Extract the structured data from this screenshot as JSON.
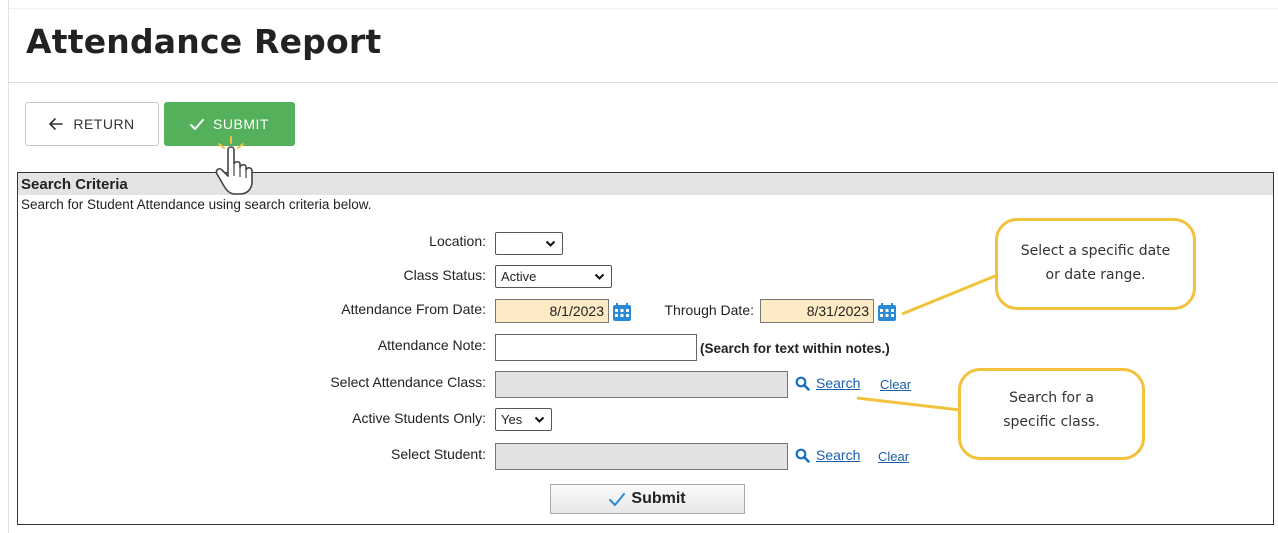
{
  "page": {
    "title": "Attendance Report"
  },
  "toolbar": {
    "return_label": "RETURN",
    "submit_label": "SUBMIT"
  },
  "panel": {
    "header": "Search Criteria",
    "subtitle": "Search for Student Attendance using search criteria below."
  },
  "form": {
    "location": {
      "label": "Location:",
      "value": ""
    },
    "class_status": {
      "label": "Class Status:",
      "value": "Active"
    },
    "from_date": {
      "label": "Attendance From Date:",
      "value": "8/1/2023"
    },
    "through_date": {
      "label": "Through Date:",
      "value": "8/31/2023"
    },
    "note": {
      "label": "Attendance Note:",
      "value": "",
      "hint": "(Search for text within notes.)"
    },
    "attendance_class": {
      "label": "Select Attendance Class:",
      "value": "",
      "search": "Search",
      "clear": "Clear"
    },
    "active_only": {
      "label": "Active Students Only:",
      "value": "Yes"
    },
    "student": {
      "label": "Select Student:",
      "value": "",
      "search": "Search",
      "clear": "Clear"
    },
    "submit_label": "Submit"
  },
  "callouts": {
    "date": {
      "line1": "Select a specific date",
      "line2": "or date range."
    },
    "class": {
      "line1": "Search for a",
      "line2": "specific class."
    }
  },
  "colors": {
    "submit_green": "#54b05a",
    "date_bg": "#fcebc4",
    "link_blue": "#1a5ea8",
    "callout_border": "#f2c23c",
    "icon_blue": "#2a8ad6"
  }
}
